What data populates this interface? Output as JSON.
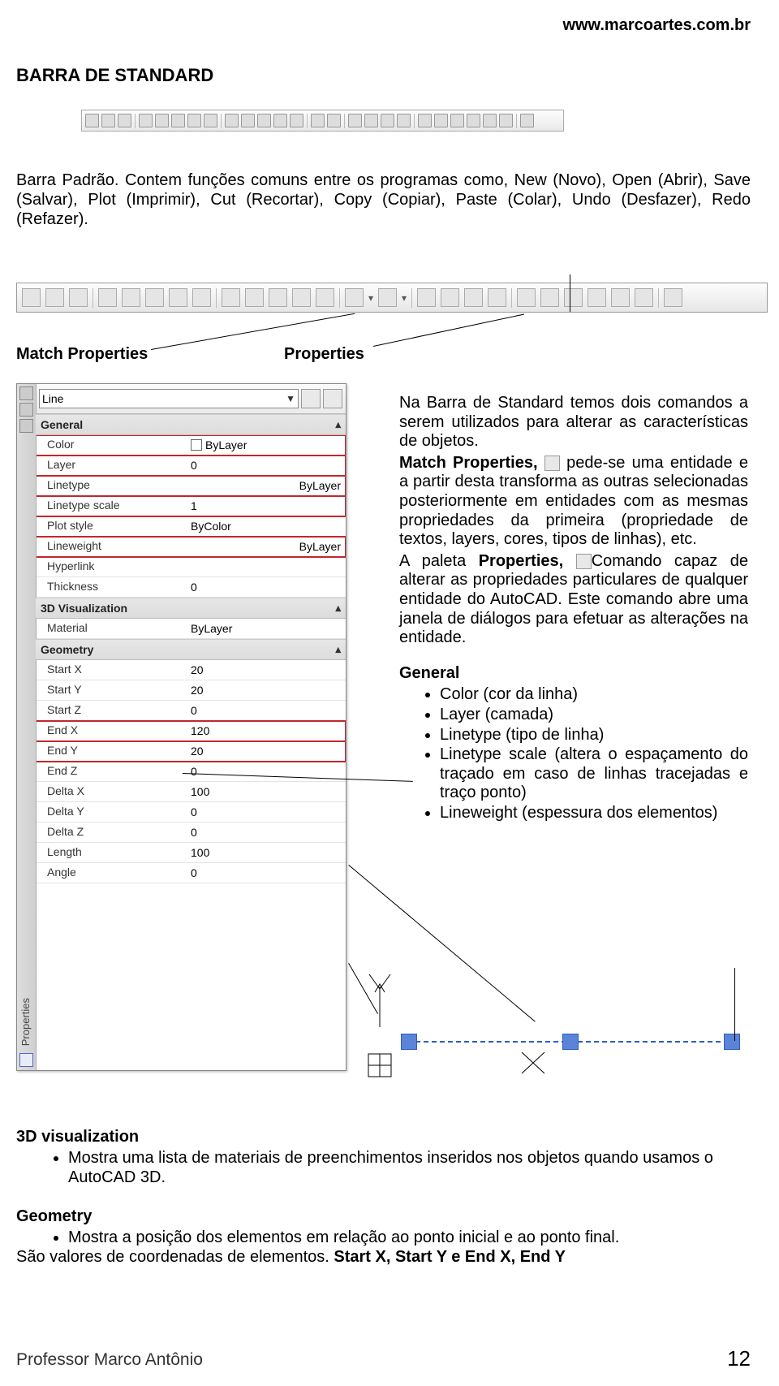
{
  "header": {
    "url": "www.marcoartes.com.br"
  },
  "title": {
    "section": "BARRA DE STANDARD"
  },
  "paragraph_intro": "Barra Padrão. Contem funções comuns entre os programas como, New (Novo), Open (Abrir), Save (Salvar), Plot (Imprimir), Cut (Recortar), Copy (Copiar), Paste (Colar), Undo (Desfazer), Redo (Refazer).",
  "labels": {
    "match_properties": "Match Properties",
    "properties": "Properties"
  },
  "properties_panel": {
    "title_vertical": "Properties",
    "object_type": "Line",
    "groups": {
      "general": {
        "label": "General",
        "rows": {
          "color": {
            "lab": "Color",
            "val": "ByLayer"
          },
          "layer": {
            "lab": "Layer",
            "val": "0"
          },
          "linetype": {
            "lab": "Linetype",
            "val": "ByLayer"
          },
          "linetype_scale": {
            "lab": "Linetype scale",
            "val": "1"
          },
          "plot_style": {
            "lab": "Plot style",
            "val": "ByColor"
          },
          "lineweight": {
            "lab": "Lineweight",
            "val": "ByLayer"
          },
          "hyperlink": {
            "lab": "Hyperlink",
            "val": ""
          },
          "thickness": {
            "lab": "Thickness",
            "val": "0"
          }
        }
      },
      "visualization_3d": {
        "label": "3D Visualization",
        "rows": {
          "material": {
            "lab": "Material",
            "val": "ByLayer"
          }
        }
      },
      "geometry": {
        "label": "Geometry",
        "rows": {
          "start_x": {
            "lab": "Start X",
            "val": "20"
          },
          "start_y": {
            "lab": "Start Y",
            "val": "20"
          },
          "start_z": {
            "lab": "Start Z",
            "val": "0"
          },
          "end_x": {
            "lab": "End X",
            "val": "120"
          },
          "end_y": {
            "lab": "End Y",
            "val": "20"
          },
          "end_z": {
            "lab": "End Z",
            "val": "0"
          },
          "delta_x": {
            "lab": "Delta X",
            "val": "100"
          },
          "delta_y": {
            "lab": "Delta Y",
            "val": "0"
          },
          "delta_z": {
            "lab": "Delta Z",
            "val": "0"
          },
          "length": {
            "lab": "Length",
            "val": "100"
          },
          "angle": {
            "lab": "Angle",
            "val": "0"
          }
        }
      }
    }
  },
  "right_text": {
    "p1a": "Na Barra de Standard temos dois comandos a serem utilizados para alterar as características de objetos.",
    "p2a": "Match Properties,",
    "p2b": " pede-se uma entidade e a partir desta transforma as outras selecionadas posteriormente em entidades com as mesmas propriedades da primeira (propriedade de textos, layers, cores, tipos de linhas), etc.",
    "p3a": "A paleta ",
    "p3b": "Properties,",
    "p3c": "Comando capaz de alterar as propriedades particulares de qualquer entidade do AutoCAD. Este comando abre uma janela de diálogos para efetuar as alterações na entidade.",
    "general_title": "General",
    "bullets": {
      "b1": "Color (cor da linha)",
      "b2": "Layer (camada)",
      "b3": "Linetype (tipo de linha)",
      "b4": "Linetype scale (altera o espaçamento do traçado em caso de linhas tracejadas e traço ponto)",
      "b5": "Lineweight (espessura dos elementos)"
    }
  },
  "bottom": {
    "vis_title": "3D visualization",
    "vis_bullet": "Mostra uma lista de materiais de preenchimentos inseridos nos objetos quando usamos o AutoCAD 3D.",
    "geom_title": "Geometry",
    "geom_bullet": "Mostra a posição dos elementos em relação ao ponto inicial e ao ponto final.",
    "geom_line2a": "São valores de coordenadas de elementos. ",
    "geom_line2b": "Start X, Start Y e End X, End Y"
  },
  "footer": {
    "left": "Professor Marco Antônio",
    "right": "12"
  }
}
